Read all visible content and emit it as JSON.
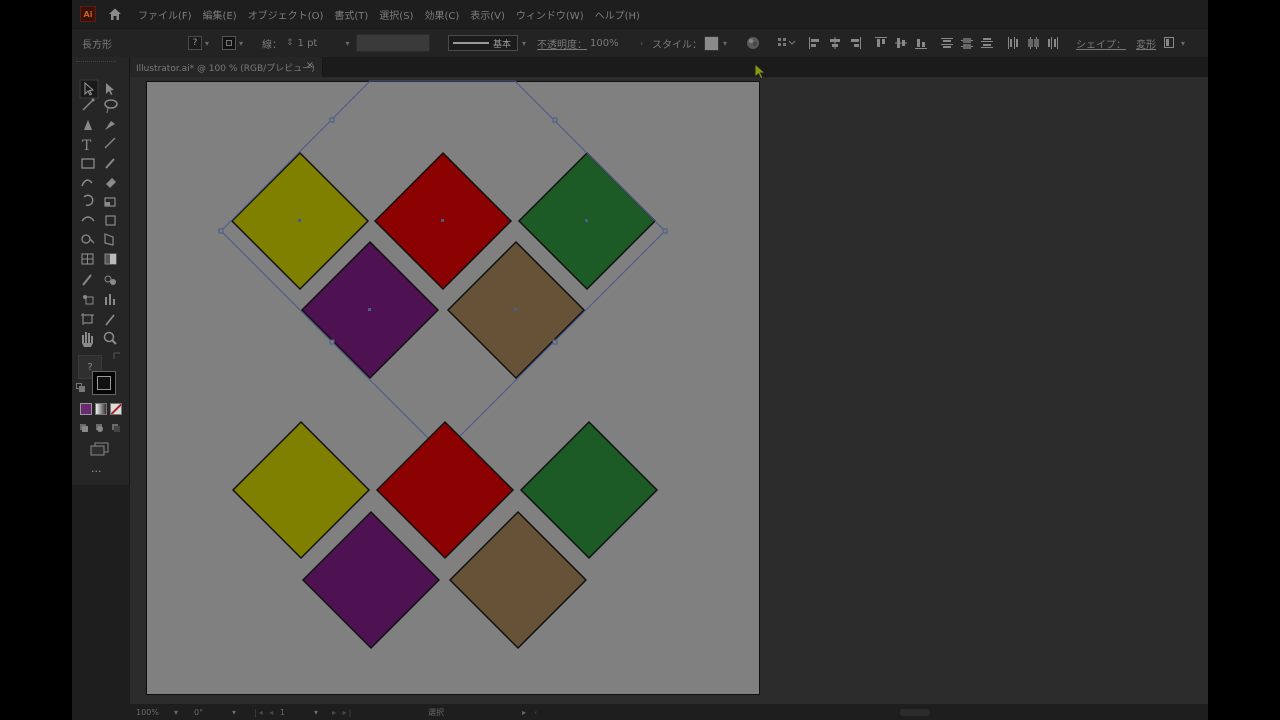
{
  "menu": {
    "items": [
      "ファイル(F)",
      "編集(E)",
      "オブジェクト(O)",
      "書式(T)",
      "選択(S)",
      "効果(C)",
      "表示(V)",
      "ウィンドウ(W)",
      "ヘルプ(H)"
    ]
  },
  "control": {
    "object_type": "長方形",
    "stroke_label": "線：",
    "stroke_weight": "1 pt",
    "brush_label": "基本",
    "opacity_label": "不透明度：",
    "opacity_value": "100%",
    "style_label": "スタイル：",
    "shape_label": "シェイプ：",
    "transform_label": "変形"
  },
  "tab": {
    "title": "Illustrator.ai* @ 100 % (RGB/プレビュー)",
    "close": "×"
  },
  "status": {
    "zoom": "100%",
    "rotation": "0°",
    "artboard_number": "1",
    "tool_name": "選択"
  },
  "toolbar": {
    "unknown_tool": "?",
    "more": "..."
  },
  "colors": {
    "yellow": "#808000",
    "red": "#8b0000",
    "green": "#1d5b26",
    "purple": "#4e1252",
    "brown": "#655237",
    "artboard": "#808080",
    "selection": "#4a5a8a"
  }
}
